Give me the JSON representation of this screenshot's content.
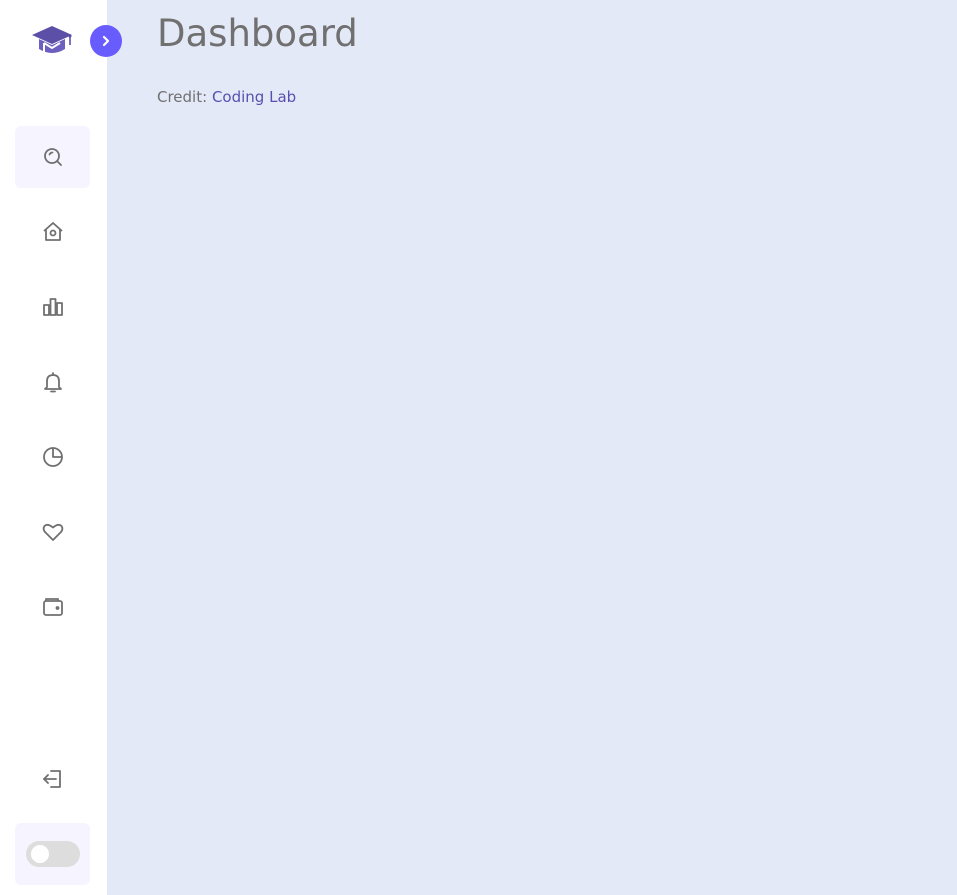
{
  "page": {
    "title": "Dashboard",
    "credit_label": "Credit:",
    "credit_link": "Coding Lab"
  },
  "sidebar": {
    "logo_icon": "graduation-cap-icon",
    "toggle_icon": "chevron-right-icon",
    "items": [
      {
        "icon": "search-icon"
      },
      {
        "icon": "home-icon"
      },
      {
        "icon": "bar-chart-icon"
      },
      {
        "icon": "bell-icon"
      },
      {
        "icon": "pie-chart-icon"
      },
      {
        "icon": "heart-icon"
      },
      {
        "icon": "wallet-icon"
      }
    ],
    "logout_icon": "logout-icon",
    "dark_mode_toggle": {
      "state": "off"
    }
  },
  "colors": {
    "accent": "#695cfe",
    "background": "#e4e9f7",
    "sidebar": "#ffffff",
    "text": "#707070"
  }
}
